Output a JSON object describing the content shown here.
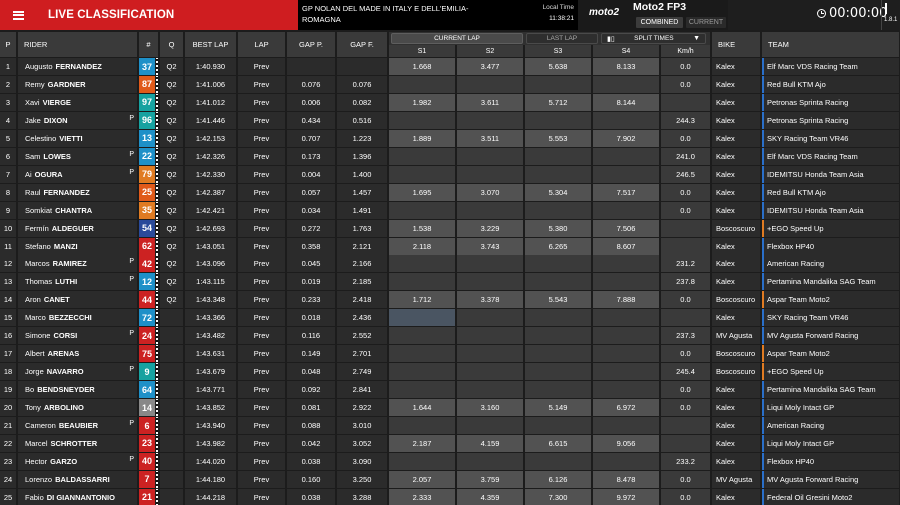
{
  "header": {
    "title": "LIVE CLASSIFICATION",
    "event": "GP NOLAN DEL MADE IN ITALY E DELL'EMILIA-ROMAGNA",
    "local_time_label": "Local Time",
    "local_time": "11:38:21",
    "series_logo": "moto2",
    "session": "Moto2 FP3",
    "btn_combined": "COMBINED",
    "btn_current": "CURRENT",
    "clock": "00:00:00",
    "version": "1.8.1"
  },
  "columns": {
    "pos": "P",
    "rider": "RIDER",
    "num": "#",
    "q": "Q",
    "best": "BEST LAP",
    "lap": "LAP",
    "gapp": "GAP P.",
    "gapf": "GAP F.",
    "current_lap": "CURRENT LAP",
    "last_lap": "LAST LAP",
    "split_times": "SPLIT TIMES",
    "s1": "S1",
    "s2": "S2",
    "s3": "S3",
    "s4": "S4",
    "kmh": "Km/h",
    "bike": "BIKE",
    "team": "TEAM"
  },
  "colors": {
    "accent": "#cf1d20",
    "kalex_team_tag": "#2a6fc9",
    "boscoscuro_team_tag": "#e07b22"
  },
  "rows": [
    {
      "pos": "1",
      "first": "Augusto",
      "last": "FERNANDEZ",
      "p": "",
      "num": "37",
      "numbg": "#1e90c8",
      "q": "Q2",
      "best": "1:40.930",
      "lap": "Prev",
      "gapp": "",
      "gapf": "",
      "s1": "1.668",
      "s2": "3.477",
      "s3": "5.638",
      "s4": "8.133",
      "kmh": "0.0",
      "bike": "Kalex",
      "team": "Elf Marc VDS Racing Team",
      "tag": "#2a6fc9",
      "split": "full"
    },
    {
      "pos": "2",
      "first": "Remy",
      "last": "GARDNER",
      "p": "",
      "num": "87",
      "numbg": "#e05a1a",
      "q": "Q2",
      "best": "1:41.006",
      "lap": "Prev",
      "gapp": "0.076",
      "gapf": "0.076",
      "s1": "",
      "s2": "",
      "s3": "",
      "s4": "",
      "kmh": "0.0",
      "bike": "Kalex",
      "team": "Red Bull KTM Ajo",
      "tag": "#2a6fc9",
      "split": "empty"
    },
    {
      "pos": "3",
      "first": "Xavi",
      "last": "VIERGE",
      "p": "",
      "num": "97",
      "numbg": "#16a2a0",
      "q": "Q2",
      "best": "1:41.012",
      "lap": "Prev",
      "gapp": "0.006",
      "gapf": "0.082",
      "s1": "1.982",
      "s2": "3.611",
      "s3": "5.712",
      "s4": "8.144",
      "kmh": "",
      "bike": "Kalex",
      "team": "Petronas Sprinta Racing",
      "tag": "#2a6fc9",
      "split": "full"
    },
    {
      "pos": "4",
      "first": "Jake",
      "last": "DIXON",
      "p": "P",
      "num": "96",
      "numbg": "#16a2a0",
      "q": "Q2",
      "best": "1:41.446",
      "lap": "Prev",
      "gapp": "0.434",
      "gapf": "0.516",
      "s1": "",
      "s2": "",
      "s3": "",
      "s4": "",
      "kmh": "244.3",
      "bike": "Kalex",
      "team": "Petronas Sprinta Racing",
      "tag": "#2a6fc9",
      "split": "empty"
    },
    {
      "pos": "5",
      "first": "Celestino",
      "last": "VIETTI",
      "p": "",
      "num": "13",
      "numbg": "#1e90c8",
      "q": "Q2",
      "best": "1:42.153",
      "lap": "Prev",
      "gapp": "0.707",
      "gapf": "1.223",
      "s1": "1.889",
      "s2": "3.511",
      "s3": "5.553",
      "s4": "7.902",
      "kmh": "0.0",
      "bike": "Kalex",
      "team": "SKY Racing Team VR46",
      "tag": "#2a6fc9",
      "split": "full"
    },
    {
      "pos": "6",
      "first": "Sam",
      "last": "LOWES",
      "p": "P",
      "num": "22",
      "numbg": "#1e90c8",
      "q": "Q2",
      "best": "1:42.326",
      "lap": "Prev",
      "gapp": "0.173",
      "gapf": "1.396",
      "s1": "",
      "s2": "",
      "s3": "",
      "s4": "",
      "kmh": "241.0",
      "bike": "Kalex",
      "team": "Elf Marc VDS Racing Team",
      "tag": "#2a6fc9",
      "split": "empty"
    },
    {
      "pos": "7",
      "first": "Ai",
      "last": "OGURA",
      "p": "P",
      "num": "79",
      "numbg": "#e07b22",
      "q": "Q2",
      "best": "1:42.330",
      "lap": "Prev",
      "gapp": "0.004",
      "gapf": "1.400",
      "s1": "",
      "s2": "",
      "s3": "",
      "s4": "",
      "kmh": "246.5",
      "bike": "Kalex",
      "team": "IDEMITSU Honda Team Asia",
      "tag": "#2a6fc9",
      "split": "empty"
    },
    {
      "pos": "8",
      "first": "Raul",
      "last": "FERNANDEZ",
      "p": "",
      "num": "25",
      "numbg": "#e05a1a",
      "q": "Q2",
      "best": "1:42.387",
      "lap": "Prev",
      "gapp": "0.057",
      "gapf": "1.457",
      "s1": "1.695",
      "s2": "3.070",
      "s3": "5.304",
      "s4": "7.517",
      "kmh": "0.0",
      "bike": "Kalex",
      "team": "Red Bull KTM Ajo",
      "tag": "#2a6fc9",
      "split": "full"
    },
    {
      "pos": "9",
      "first": "Somkiat",
      "last": "CHANTRA",
      "p": "",
      "num": "35",
      "numbg": "#e07b22",
      "q": "Q2",
      "best": "1:42.421",
      "lap": "Prev",
      "gapp": "0.034",
      "gapf": "1.491",
      "s1": "",
      "s2": "",
      "s3": "",
      "s4": "",
      "kmh": "0.0",
      "bike": "Kalex",
      "team": "IDEMITSU Honda Team Asia",
      "tag": "#2a6fc9",
      "split": "empty"
    },
    {
      "pos": "10",
      "first": "Fermín",
      "last": "ALDEGUER",
      "p": "",
      "num": "54",
      "numbg": "#2a4a9a",
      "q": "Q2",
      "best": "1:42.693",
      "lap": "Prev",
      "gapp": "0.272",
      "gapf": "1.763",
      "s1": "1.538",
      "s2": "3.229",
      "s3": "5.380",
      "s4": "7.506",
      "kmh": "",
      "bike": "Boscoscuro",
      "team": "+EGO Speed Up",
      "tag": "#e07b22",
      "split": "full"
    },
    {
      "pos": "11",
      "first": "Stefano",
      "last": "MANZI",
      "p": "",
      "num": "62",
      "numbg": "#cc2222",
      "q": "Q2",
      "best": "1:43.051",
      "lap": "Prev",
      "gapp": "0.358",
      "gapf": "2.121",
      "s1": "2.118",
      "s2": "3.743",
      "s3": "6.265",
      "s4": "8.607",
      "kmh": "",
      "bike": "Kalex",
      "team": "Flexbox HP40",
      "tag": "#2a6fc9",
      "split": "full"
    },
    {
      "pos": "12",
      "first": "Marcos",
      "last": "RAMIREZ",
      "p": "P",
      "num": "42",
      "numbg": "#cc2222",
      "q": "Q2",
      "best": "1:43.096",
      "lap": "Prev",
      "gapp": "0.045",
      "gapf": "2.166",
      "s1": "",
      "s2": "",
      "s3": "",
      "s4": "",
      "kmh": "231.2",
      "bike": "Kalex",
      "team": "American Racing",
      "tag": "#2a6fc9",
      "split": "empty"
    },
    {
      "pos": "13",
      "first": "Thomas",
      "last": "LUTHI",
      "p": "P",
      "num": "12",
      "numbg": "#1e90c8",
      "q": "Q2",
      "best": "1:43.115",
      "lap": "Prev",
      "gapp": "0.019",
      "gapf": "2.185",
      "s1": "",
      "s2": "",
      "s3": "",
      "s4": "",
      "kmh": "237.8",
      "bike": "Kalex",
      "team": "Pertamina Mandalika SAG Team",
      "tag": "#2a6fc9",
      "split": "empty"
    },
    {
      "pos": "14",
      "first": "Aron",
      "last": "CANET",
      "p": "",
      "num": "44",
      "numbg": "#cc2222",
      "q": "Q2",
      "best": "1:43.348",
      "lap": "Prev",
      "gapp": "0.233",
      "gapf": "2.418",
      "s1": "1.712",
      "s2": "3.378",
      "s3": "5.543",
      "s4": "7.888",
      "kmh": "0.0",
      "bike": "Boscoscuro",
      "team": "Aspar Team Moto2",
      "tag": "#e07b22",
      "split": "full"
    },
    {
      "pos": "15",
      "first": "Marco",
      "last": "BEZZECCHI",
      "p": "",
      "num": "72",
      "numbg": "#1e90c8",
      "q": "",
      "best": "1:43.366",
      "lap": "Prev",
      "gapp": "0.018",
      "gapf": "2.436",
      "s1": "",
      "s2": "",
      "s3": "",
      "s4": "",
      "kmh": "",
      "bike": "Kalex",
      "team": "SKY Racing Team VR46",
      "tag": "#2a6fc9",
      "split": "blue"
    },
    {
      "pos": "16",
      "first": "Simone",
      "last": "CORSI",
      "p": "P",
      "num": "24",
      "numbg": "#cc2222",
      "q": "",
      "best": "1:43.482",
      "lap": "Prev",
      "gapp": "0.116",
      "gapf": "2.552",
      "s1": "",
      "s2": "",
      "s3": "",
      "s4": "",
      "kmh": "237.3",
      "bike": "MV Agusta",
      "team": "MV Agusta Forward Racing",
      "tag": "#2a6fc9",
      "split": "empty"
    },
    {
      "pos": "17",
      "first": "Albert",
      "last": "ARENAS",
      "p": "",
      "num": "75",
      "numbg": "#cc2222",
      "q": "",
      "best": "1:43.631",
      "lap": "Prev",
      "gapp": "0.149",
      "gapf": "2.701",
      "s1": "",
      "s2": "",
      "s3": "",
      "s4": "",
      "kmh": "0.0",
      "bike": "Boscoscuro",
      "team": "Aspar Team Moto2",
      "tag": "#e07b22",
      "split": "empty"
    },
    {
      "pos": "18",
      "first": "Jorge",
      "last": "NAVARRO",
      "p": "P",
      "num": "9",
      "numbg": "#16a2a0",
      "q": "",
      "best": "1:43.679",
      "lap": "Prev",
      "gapp": "0.048",
      "gapf": "2.749",
      "s1": "",
      "s2": "",
      "s3": "",
      "s4": "",
      "kmh": "245.4",
      "bike": "Boscoscuro",
      "team": "+EGO Speed Up",
      "tag": "#e07b22",
      "split": "empty"
    },
    {
      "pos": "19",
      "first": "Bo",
      "last": "BENDSNEYDER",
      "p": "",
      "num": "64",
      "numbg": "#1e90c8",
      "q": "",
      "best": "1:43.771",
      "lap": "Prev",
      "gapp": "0.092",
      "gapf": "2.841",
      "s1": "",
      "s2": "",
      "s3": "",
      "s4": "",
      "kmh": "0.0",
      "bike": "Kalex",
      "team": "Pertamina Mandalika SAG Team",
      "tag": "#2a6fc9",
      "split": "empty"
    },
    {
      "pos": "20",
      "first": "Tony",
      "last": "ARBOLINO",
      "p": "",
      "num": "14",
      "numbg": "#888888",
      "q": "",
      "best": "1:43.852",
      "lap": "Prev",
      "gapp": "0.081",
      "gapf": "2.922",
      "s1": "1.644",
      "s2": "3.160",
      "s3": "5.149",
      "s4": "6.972",
      "kmh": "0.0",
      "bike": "Kalex",
      "team": "Liqui Moly Intact GP",
      "tag": "#2a6fc9",
      "split": "full"
    },
    {
      "pos": "21",
      "first": "Cameron",
      "last": "BEAUBIER",
      "p": "P",
      "num": "6",
      "numbg": "#cc2222",
      "q": "",
      "best": "1:43.940",
      "lap": "Prev",
      "gapp": "0.088",
      "gapf": "3.010",
      "s1": "",
      "s2": "",
      "s3": "",
      "s4": "",
      "kmh": "",
      "bike": "Kalex",
      "team": "American Racing",
      "tag": "#2a6fc9",
      "split": "empty"
    },
    {
      "pos": "22",
      "first": "Marcel",
      "last": "SCHROTTER",
      "p": "",
      "num": "23",
      "numbg": "#cc2222",
      "q": "",
      "best": "1:43.982",
      "lap": "Prev",
      "gapp": "0.042",
      "gapf": "3.052",
      "s1": "2.187",
      "s2": "4.159",
      "s3": "6.615",
      "s4": "9.056",
      "kmh": "",
      "bike": "Kalex",
      "team": "Liqui Moly Intact GP",
      "tag": "#2a6fc9",
      "split": "full"
    },
    {
      "pos": "23",
      "first": "Hector",
      "last": "GARZO",
      "p": "P",
      "num": "40",
      "numbg": "#cc2222",
      "q": "",
      "best": "1:44.020",
      "lap": "Prev",
      "gapp": "0.038",
      "gapf": "3.090",
      "s1": "",
      "s2": "",
      "s3": "",
      "s4": "",
      "kmh": "233.2",
      "bike": "Kalex",
      "team": "Flexbox HP40",
      "tag": "#2a6fc9",
      "split": "empty"
    },
    {
      "pos": "24",
      "first": "Lorenzo",
      "last": "BALDASSARRI",
      "p": "",
      "num": "7",
      "numbg": "#cc2222",
      "q": "",
      "best": "1:44.180",
      "lap": "Prev",
      "gapp": "0.160",
      "gapf": "3.250",
      "s1": "2.057",
      "s2": "3.759",
      "s3": "6.126",
      "s4": "8.478",
      "kmh": "0.0",
      "bike": "MV Agusta",
      "team": "MV Agusta Forward Racing",
      "tag": "#2a6fc9",
      "split": "full"
    },
    {
      "pos": "25",
      "first": "Fabio",
      "last": "DI GIANNANTONIO",
      "p": "",
      "num": "21",
      "numbg": "#cc2222",
      "q": "",
      "best": "1:44.218",
      "lap": "Prev",
      "gapp": "0.038",
      "gapf": "3.288",
      "s1": "2.333",
      "s2": "4.359",
      "s3": "7.300",
      "s4": "9.972",
      "kmh": "0.0",
      "bike": "Kalex",
      "team": "Federal Oil Gresini Moto2",
      "tag": "#2a6fc9",
      "split": "full"
    }
  ]
}
